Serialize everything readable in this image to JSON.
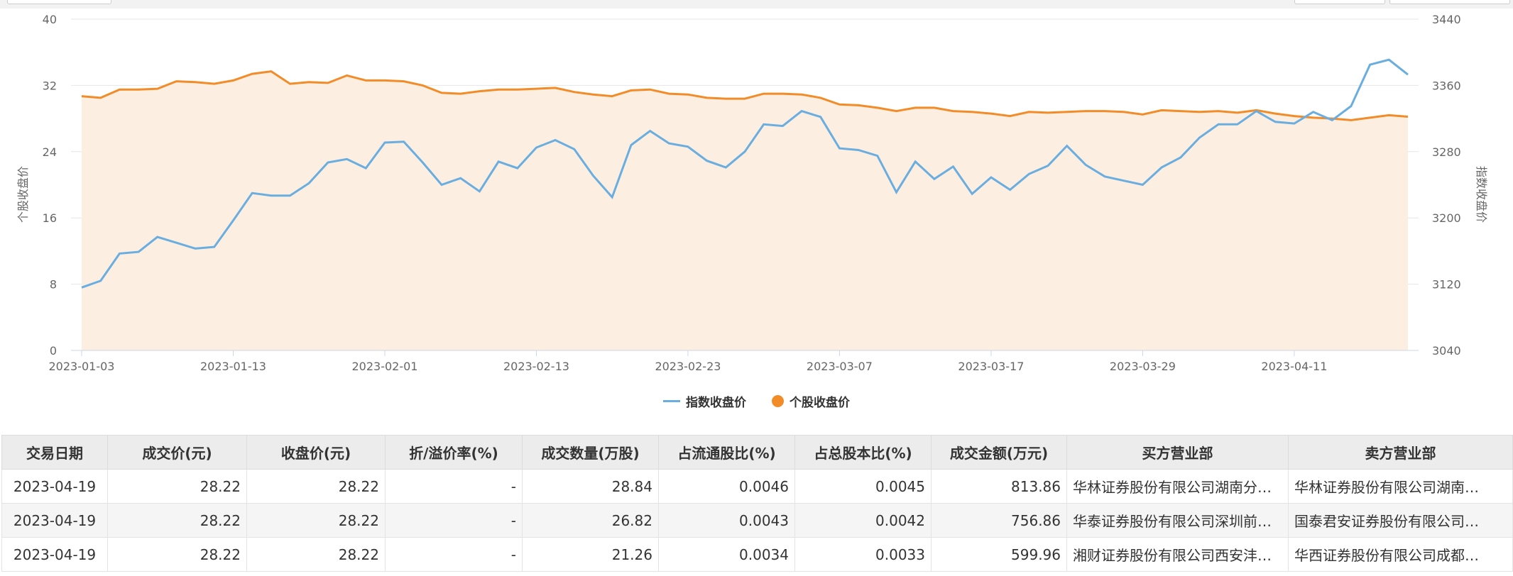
{
  "chart_data": {
    "type": "line",
    "y_left_label": "个股收盘价",
    "y_right_label": "指数收盘价",
    "y_left_ticks": [
      "0",
      "8",
      "16",
      "24",
      "32",
      "40"
    ],
    "y_right_ticks": [
      "3040",
      "3120",
      "3200",
      "3280",
      "3360",
      "3440"
    ],
    "ylim_left": [
      0,
      40
    ],
    "ylim_right": [
      3040,
      3440
    ],
    "x_tick_labels": [
      "2023-01-03",
      "2023-01-13",
      "2023-02-01",
      "2023-02-13",
      "2023-02-23",
      "2023-03-07",
      "2023-03-17",
      "2023-03-29",
      "2023-04-11"
    ],
    "x_tick_indices": [
      0,
      8,
      16,
      24,
      32,
      40,
      48,
      56,
      64
    ],
    "x_count": 71,
    "grid": true,
    "legend_position": "bottom-center",
    "series": [
      {
        "name": "指数收盘价",
        "axis": "right",
        "color": "#6aaee0",
        "values": [
          3116,
          3124,
          3157,
          3159,
          3177,
          3170,
          3163,
          3165,
          3197,
          3230,
          3227,
          3227,
          3242,
          3267,
          3271,
          3260,
          3291,
          3292,
          3267,
          3240,
          3248,
          3232,
          3268,
          3260,
          3285,
          3294,
          3283,
          3251,
          3225,
          3288,
          3305,
          3290,
          3286,
          3269,
          3261,
          3280,
          3313,
          3311,
          3329,
          3322,
          3284,
          3282,
          3275,
          3231,
          3268,
          3247,
          3262,
          3229,
          3249,
          3234,
          3253,
          3263,
          3287,
          3264,
          3250,
          3245,
          3240,
          3261,
          3273,
          3297,
          3313,
          3313,
          3329,
          3316,
          3314,
          3328,
          3318,
          3335,
          3385,
          3391,
          3373
        ]
      },
      {
        "name": "个股收盘价",
        "axis": "left",
        "color": "#f28c28",
        "fill": "#fdeee2",
        "values": [
          30.7,
          30.5,
          31.5,
          31.5,
          31.6,
          32.5,
          32.4,
          32.2,
          32.6,
          33.4,
          33.7,
          32.2,
          32.4,
          32.3,
          33.2,
          32.6,
          32.6,
          32.5,
          32.0,
          31.1,
          31.0,
          31.3,
          31.5,
          31.5,
          31.6,
          31.7,
          31.2,
          30.9,
          30.7,
          31.4,
          31.5,
          31.0,
          30.9,
          30.5,
          30.4,
          30.4,
          31.0,
          31.0,
          30.9,
          30.5,
          29.7,
          29.6,
          29.3,
          28.9,
          29.3,
          29.3,
          28.9,
          28.8,
          28.6,
          28.3,
          28.8,
          28.7,
          28.8,
          28.9,
          28.9,
          28.8,
          28.5,
          29.0,
          28.9,
          28.8,
          28.9,
          28.7,
          29.0,
          28.6,
          28.3,
          28.1,
          28.0,
          27.8,
          28.1,
          28.4,
          28.22
        ]
      }
    ]
  },
  "table": {
    "headers": [
      "交易日期",
      "成交价(元)",
      "收盘价(元)",
      "折/溢价率(%)",
      "成交数量(万股)",
      "占流通股比(%)",
      "占总股本比(%)",
      "成交金额(万元)",
      "买方营业部",
      "卖方营业部"
    ],
    "rows": [
      [
        "2023-04-19",
        "28.22",
        "28.22",
        "-",
        "28.84",
        "0.0046",
        "0.0045",
        "813.86",
        "华林证券股份有限公司湖南分…",
        "华林证券股份有限公司湖南…"
      ],
      [
        "2023-04-19",
        "28.22",
        "28.22",
        "-",
        "26.82",
        "0.0043",
        "0.0042",
        "756.86",
        "华泰证券股份有限公司深圳前…",
        "国泰君安证券股份有限公司…"
      ],
      [
        "2023-04-19",
        "28.22",
        "28.22",
        "-",
        "21.26",
        "0.0034",
        "0.0033",
        "599.96",
        "湘财证券股份有限公司西安沣…",
        "华西证券股份有限公司成都…"
      ]
    ]
  }
}
